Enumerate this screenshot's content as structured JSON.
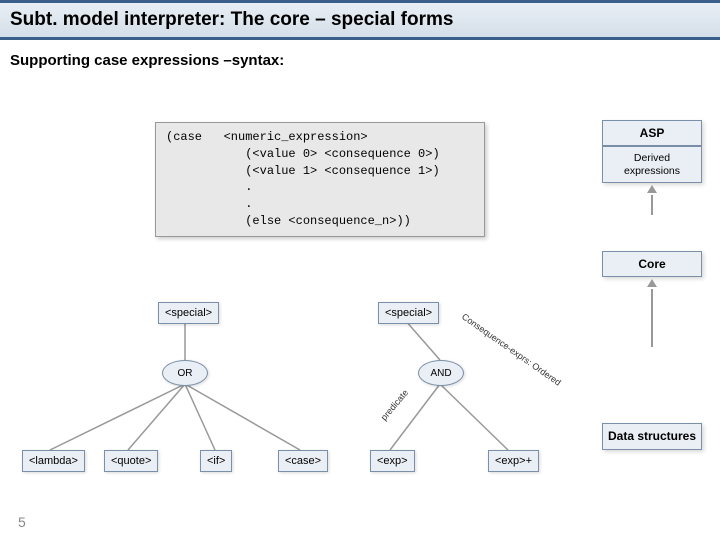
{
  "title": "Subt. model interpreter:   The core – special forms",
  "subtitle": "Supporting case expressions –syntax:",
  "code": "(case   <numeric_expression>\n           (<value 0> <consequence 0>)\n           (<value 1> <consequence 1>)\n           .\n           .\n           (else <consequence_n>))",
  "side": {
    "asp": "ASP",
    "derived": "Derived expressions",
    "core": "Core",
    "data": "Data structures"
  },
  "nodes": {
    "special1": "<special>",
    "special2": "<special>",
    "or": "OR",
    "and": "AND",
    "lambda": "<lambda>",
    "quote": "<quote>",
    "if": "<if>",
    "case": "<case>",
    "exp": "<exp>",
    "expplus": "<exp>+"
  },
  "labels": {
    "predicate": "predicate",
    "consequence": "Consequence-exprs: Ordered"
  },
  "page": "5"
}
